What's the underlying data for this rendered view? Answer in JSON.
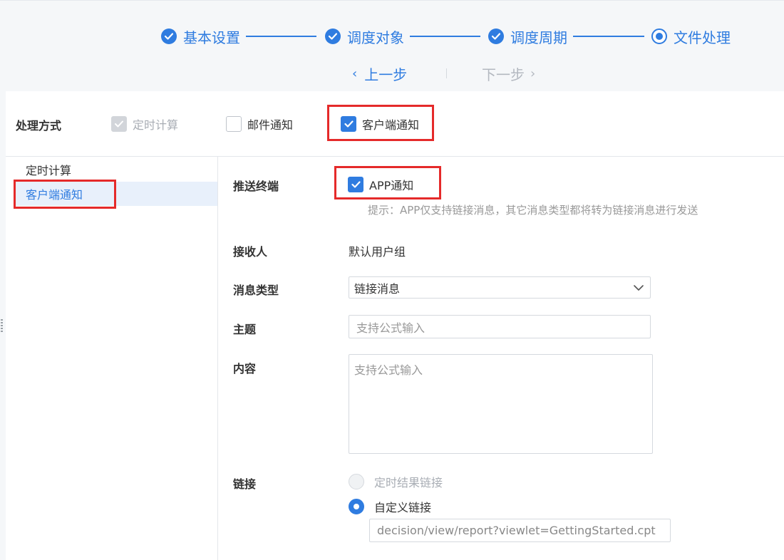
{
  "steps": [
    {
      "label": "基本设置",
      "state": "done"
    },
    {
      "label": "调度对象",
      "state": "done"
    },
    {
      "label": "调度周期",
      "state": "done"
    },
    {
      "label": "文件处理",
      "state": "current"
    }
  ],
  "nav": {
    "prev_label": "上一步",
    "next_label": "下一步"
  },
  "processing": {
    "label": "处理方式",
    "options": [
      {
        "label": "定时计算",
        "checked": true,
        "disabled": true
      },
      {
        "label": "邮件通知",
        "checked": false,
        "disabled": false
      },
      {
        "label": "客户端通知",
        "checked": true,
        "disabled": false
      }
    ]
  },
  "sidebar": {
    "items": [
      {
        "label": "定时计算",
        "active": false
      },
      {
        "label": "客户端通知",
        "active": true
      }
    ]
  },
  "form": {
    "push_terminal": {
      "label": "推送终端",
      "option_label": "APP通知",
      "checked": true,
      "hint": "提示：APP仅支持链接消息，其它消息类型都将转为链接消息进行发送"
    },
    "recipient": {
      "label": "接收人",
      "value": "默认用户组"
    },
    "message_type": {
      "label": "消息类型",
      "value": "链接消息"
    },
    "subject": {
      "label": "主题",
      "placeholder": "支持公式输入"
    },
    "content": {
      "label": "内容",
      "placeholder": "支持公式输入"
    },
    "link": {
      "label": "链接",
      "options": [
        {
          "label": "定时结果链接",
          "checked": false,
          "disabled": true
        },
        {
          "label": "自定义链接",
          "checked": true,
          "disabled": false
        }
      ],
      "custom_url": "decision/view/report?viewlet=GettingStarted.cpt"
    }
  },
  "colors": {
    "accent": "#2f7ce0",
    "highlight": "#e52a2a",
    "disabled": "#d2d5da"
  }
}
